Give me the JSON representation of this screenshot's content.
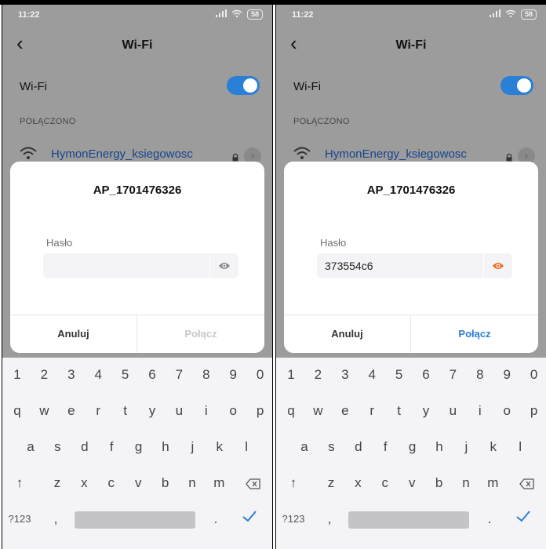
{
  "status_bar": {
    "time": "11:22",
    "battery": "58"
  },
  "header": {
    "title": "Wi-Fi"
  },
  "wifi_toggle": {
    "label": "Wi-Fi",
    "on": true
  },
  "connected_section": {
    "label": "POŁĄCZONO",
    "network_name": "HymonEnergy_ksiegowosc"
  },
  "dialogs": [
    {
      "ssid": "AP_1701476326",
      "password_label": "Hasło",
      "password_value": "",
      "cancel_label": "Anuluj",
      "connect_label": "Połącz",
      "connect_enabled": false,
      "eye_color": "#8a8a8a"
    },
    {
      "ssid": "AP_1701476326",
      "password_label": "Hasło",
      "password_value": "373554c6",
      "cancel_label": "Anuluj",
      "connect_label": "Połącz",
      "connect_enabled": true,
      "eye_color": "#f06a1e"
    }
  ],
  "keyboard": {
    "row1": [
      "1",
      "2",
      "3",
      "4",
      "5",
      "6",
      "7",
      "8",
      "9",
      "0"
    ],
    "row2": [
      "q",
      "w",
      "e",
      "r",
      "t",
      "y",
      "u",
      "i",
      "o",
      "p"
    ],
    "row3": [
      "a",
      "s",
      "d",
      "f",
      "g",
      "h",
      "j",
      "k",
      "l"
    ],
    "row4": [
      "z",
      "x",
      "c",
      "v",
      "b",
      "n",
      "m"
    ],
    "shift": "↑",
    "symbols": "?123",
    "comma": ",",
    "period": "."
  },
  "colors": {
    "accent": "#2a7fd6",
    "network_text": "#17458c",
    "eye_active": "#f06a1e",
    "overlay": "#9c9c9c"
  }
}
